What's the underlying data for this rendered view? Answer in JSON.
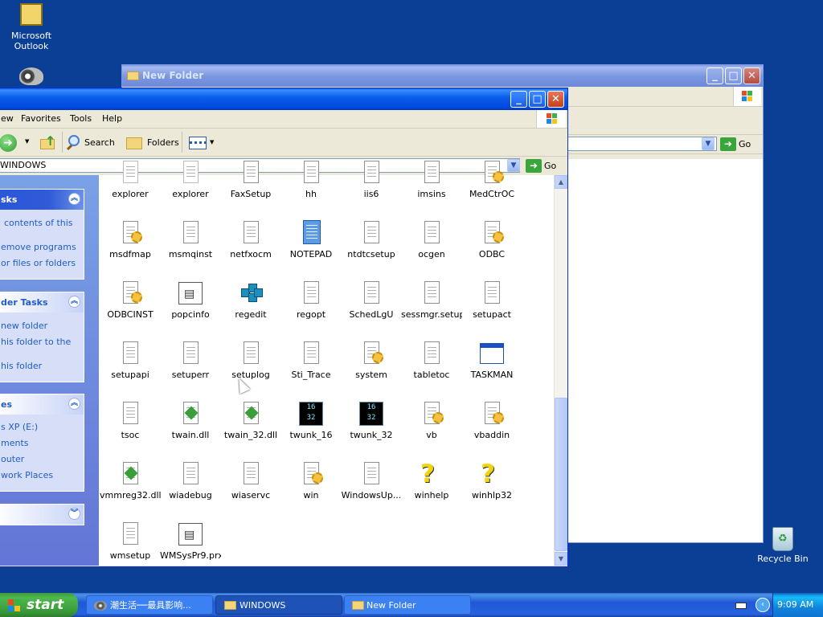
{
  "desktop": {
    "icons": [
      {
        "label": "Microsoft Outlook",
        "icon": "outlook-icon"
      },
      {
        "label": "",
        "icon": "raccoon-icon"
      },
      {
        "label": "Recycle Bin",
        "icon": "recycle-bin-icon"
      }
    ]
  },
  "back_window": {
    "title": "New Folder",
    "go_label": "Go"
  },
  "front_window": {
    "menu": [
      "ew",
      "Favorites",
      "Tools",
      "Help"
    ],
    "toolbar": {
      "search_label": "Search",
      "folders_label": "Folders"
    },
    "address": "WINDOWS",
    "go_label": "Go",
    "task_panels": [
      {
        "title": "sks",
        "items": [
          "contents of this",
          "emove programs",
          "or files or folders"
        ]
      },
      {
        "title": "der Tasks",
        "items": [
          "new folder",
          "his folder to the",
          "his folder"
        ]
      },
      {
        "title": "es",
        "items": [
          "s XP (E:)",
          "ments",
          "outer",
          "work Places"
        ]
      },
      {
        "title": "",
        "items": []
      }
    ],
    "files": [
      {
        "name": "explorer",
        "icon": "explorer-icon"
      },
      {
        "name": "explorer",
        "icon": "explorer-icon"
      },
      {
        "name": "FaxSetup",
        "icon": "text-file-icon"
      },
      {
        "name": "hh",
        "icon": "text-file-icon"
      },
      {
        "name": "iis6",
        "icon": "text-file-icon"
      },
      {
        "name": "imsins",
        "icon": "text-file-icon"
      },
      {
        "name": "MedCtrOC",
        "icon": "setup-info-icon"
      },
      {
        "name": "msdfmap",
        "icon": "setup-info-icon"
      },
      {
        "name": "msmqinst",
        "icon": "text-file-icon"
      },
      {
        "name": "netfxocm",
        "icon": "text-file-icon"
      },
      {
        "name": "NOTEPAD",
        "icon": "notepad-icon"
      },
      {
        "name": "ntdtcsetup",
        "icon": "text-file-icon"
      },
      {
        "name": "ocgen",
        "icon": "text-file-icon"
      },
      {
        "name": "ODBC",
        "icon": "setup-info-icon"
      },
      {
        "name": "ODBCINST",
        "icon": "setup-info-icon"
      },
      {
        "name": "popcinfo",
        "icon": "system-file-icon"
      },
      {
        "name": "regedit",
        "icon": "regedit-icon"
      },
      {
        "name": "regopt",
        "icon": "text-file-icon"
      },
      {
        "name": "SchedLgU",
        "icon": "text-file-icon"
      },
      {
        "name": "sessmgr.setup",
        "icon": "text-file-icon"
      },
      {
        "name": "setupact",
        "icon": "text-file-icon"
      },
      {
        "name": "setupapi",
        "icon": "text-file-icon"
      },
      {
        "name": "setuperr",
        "icon": "text-file-icon"
      },
      {
        "name": "setuplog",
        "icon": "text-file-icon"
      },
      {
        "name": "Sti_Trace",
        "icon": "text-file-icon"
      },
      {
        "name": "system",
        "icon": "setup-info-icon"
      },
      {
        "name": "tabletoc",
        "icon": "text-file-icon"
      },
      {
        "name": "TASKMAN",
        "icon": "application-window-icon"
      },
      {
        "name": "tsoc",
        "icon": "text-file-icon"
      },
      {
        "name": "twain.dll",
        "icon": "dll-icon"
      },
      {
        "name": "twain_32.dll",
        "icon": "dll-icon"
      },
      {
        "name": "twunk_16",
        "icon": "dos-program-icon"
      },
      {
        "name": "twunk_32",
        "icon": "dos-program-icon"
      },
      {
        "name": "vb",
        "icon": "setup-info-icon"
      },
      {
        "name": "vbaddin",
        "icon": "setup-info-icon"
      },
      {
        "name": "vmmreg32.dll",
        "icon": "dll-icon"
      },
      {
        "name": "wiadebug",
        "icon": "text-file-icon"
      },
      {
        "name": "wiaservc",
        "icon": "text-file-icon"
      },
      {
        "name": "win",
        "icon": "setup-info-icon"
      },
      {
        "name": "WindowsUp...",
        "icon": "text-file-icon"
      },
      {
        "name": "winhelp",
        "icon": "help-icon"
      },
      {
        "name": "winhlp32",
        "icon": "help-icon"
      },
      {
        "name": "wmsetup",
        "icon": "text-file-icon"
      },
      {
        "name": "WMSysPr9.prx",
        "icon": "system-file-icon"
      }
    ],
    "dos_label": "16\n32"
  },
  "taskbar": {
    "start_label": "start",
    "tasks": [
      {
        "label": "潮生活──最具影响...",
        "icon": "raccoon-icon"
      },
      {
        "label": "WINDOWS",
        "icon": "folder-icon"
      },
      {
        "label": "New Folder",
        "icon": "folder-icon"
      }
    ],
    "clock": "9:09 AM"
  },
  "colors": {
    "desktop": "#0a3f95",
    "title_active": "#0a5fe8",
    "task_panel_link": "#215dc6",
    "start_green": "#3c9a3c"
  }
}
